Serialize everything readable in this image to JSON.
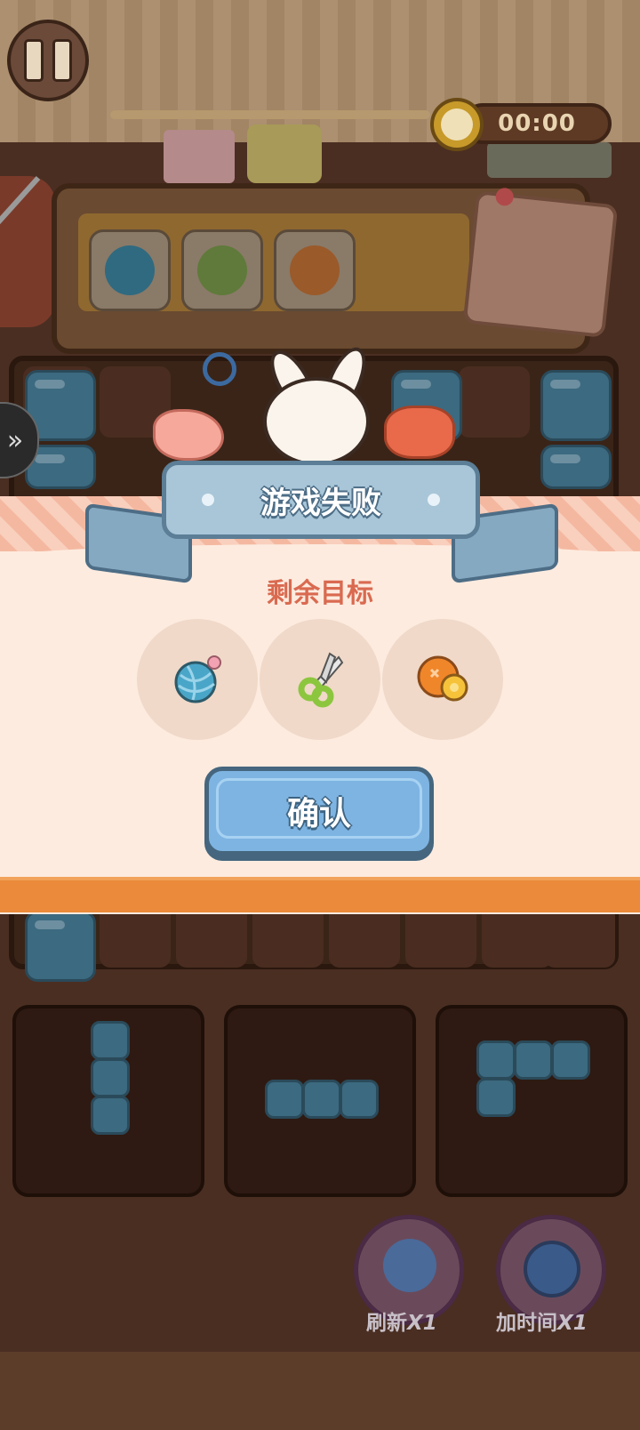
{
  "header": {
    "timer": "00:00"
  },
  "dialog": {
    "title": "游戏失败",
    "subtitle": "剩余目标",
    "goals": [
      {
        "icon": "yarn-ball-icon",
        "color": "#4aa6c8"
      },
      {
        "icon": "scissors-icon",
        "color": "#8cc63e"
      },
      {
        "icon": "button-icon",
        "color": "#f0862a"
      }
    ],
    "confirm_label": "确认"
  },
  "powerups": {
    "refresh": {
      "label": "刷新",
      "count": "X1",
      "icon": "refresh-icon"
    },
    "add_time": {
      "label": "加时间",
      "count": "X1",
      "icon": "alarm-clock-icon"
    }
  },
  "colors": {
    "ribbon": "#a8c6d8",
    "confirm": "#7eb4e2",
    "modal_bg": "#fdebdf",
    "subtitle": "#d96a50"
  }
}
